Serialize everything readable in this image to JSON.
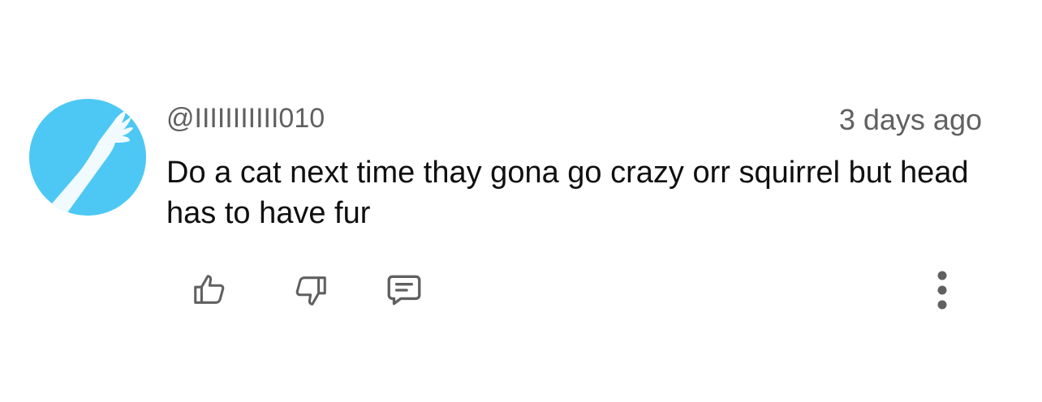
{
  "comment": {
    "author_handle": "@IIIIIIIIIII010",
    "timestamp": "3 days ago",
    "text": "Do a cat next time thay gona go crazy orr squirrel but head has to have fur",
    "avatar": {
      "icon": "hand-silhouette",
      "background_color": "#4dc8f4"
    }
  },
  "actions": {
    "like_icon": "thumbs-up-icon",
    "dislike_icon": "thumbs-down-icon",
    "reply_icon": "reply-comment-icon",
    "more_icon": "more-vertical-icon"
  },
  "colors": {
    "text_primary": "#0f0f0f",
    "text_secondary": "#606060",
    "icon": "#606060"
  }
}
